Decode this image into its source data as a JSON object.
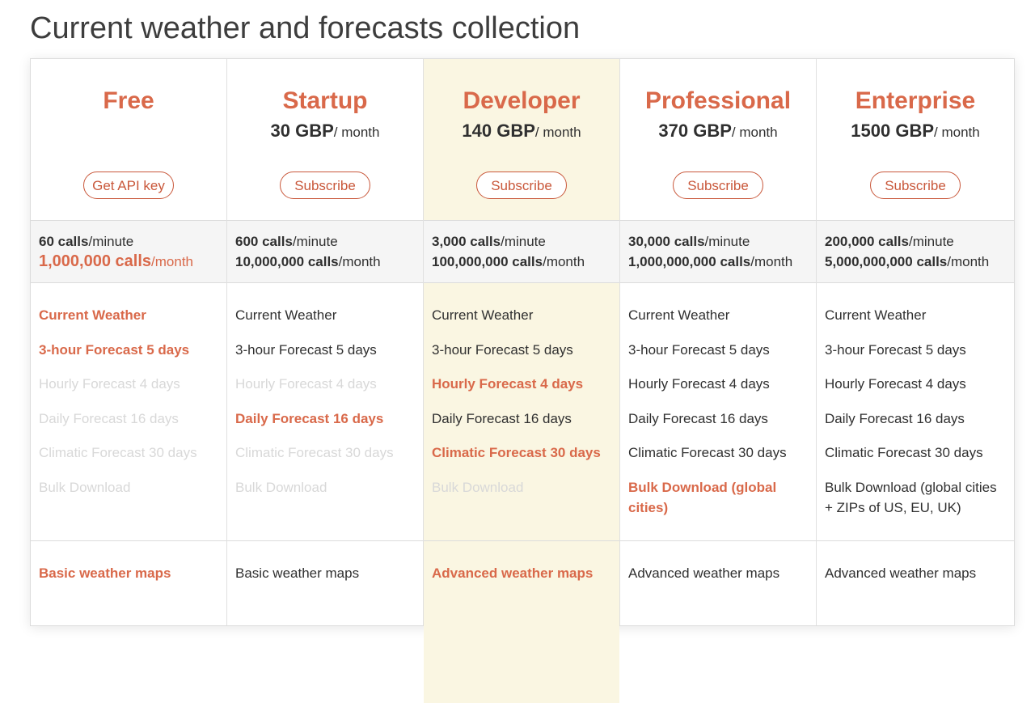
{
  "title": "Current weather and forecasts collection",
  "plans": [
    {
      "name": "Free",
      "price": "",
      "per": "",
      "button": "Get API key",
      "calls_min": [
        "60",
        " calls",
        "/minute"
      ],
      "calls_month": [
        "1,000,000",
        " calls",
        "/month"
      ],
      "features": [
        {
          "text": "Current Weather",
          "state": "hl"
        },
        {
          "text": "3-hour Forecast 5 days",
          "state": "hl"
        },
        {
          "text": "Hourly Forecast 4 days",
          "state": "off"
        },
        {
          "text": "Daily Forecast 16 days",
          "state": "off"
        },
        {
          "text": "Climatic Forecast 30 days",
          "state": "off"
        },
        {
          "text": "Bulk Download",
          "state": "off"
        }
      ],
      "maps": {
        "text": "Basic weather maps",
        "state": "hl"
      }
    },
    {
      "name": "Startup",
      "price": "30 GBP",
      "per": "/ month",
      "button": "Subscribe",
      "calls_min": [
        "600",
        " calls",
        "/minute"
      ],
      "calls_month": [
        "10,000,000",
        " calls",
        "/month"
      ],
      "features": [
        {
          "text": "Current Weather",
          "state": "on"
        },
        {
          "text": "3-hour Forecast 5 days",
          "state": "on"
        },
        {
          "text": "Hourly Forecast 4 days",
          "state": "off"
        },
        {
          "text": "Daily Forecast 16 days",
          "state": "hl"
        },
        {
          "text": "Climatic Forecast 30 days",
          "state": "off"
        },
        {
          "text": "Bulk Download",
          "state": "off"
        }
      ],
      "maps": {
        "text": "Basic weather maps",
        "state": "on"
      }
    },
    {
      "name": "Developer",
      "price": "140 GBP",
      "per": "/ month",
      "button": "Subscribe",
      "calls_min": [
        "3,000",
        " calls",
        "/minute"
      ],
      "calls_month": [
        "100,000,000",
        " calls",
        "/month"
      ],
      "features": [
        {
          "text": "Current Weather",
          "state": "on"
        },
        {
          "text": "3-hour Forecast 5 days",
          "state": "on"
        },
        {
          "text": "Hourly Forecast 4 days",
          "state": "hl"
        },
        {
          "text": "Daily Forecast 16 days",
          "state": "on"
        },
        {
          "text": "Climatic Forecast 30 days",
          "state": "hl"
        },
        {
          "text": "Bulk Download",
          "state": "off"
        }
      ],
      "maps": {
        "text": "Advanced weather maps",
        "state": "hl"
      }
    },
    {
      "name": "Professional",
      "price": "370 GBP",
      "per": "/ month",
      "button": "Subscribe",
      "calls_min": [
        "30,000",
        " calls",
        "/minute"
      ],
      "calls_month": [
        "1,000,000,000",
        " calls",
        "/month"
      ],
      "features": [
        {
          "text": "Current Weather",
          "state": "on"
        },
        {
          "text": "3-hour Forecast 5 days",
          "state": "on"
        },
        {
          "text": "Hourly Forecast 4 days",
          "state": "on"
        },
        {
          "text": "Daily Forecast 16 days",
          "state": "on"
        },
        {
          "text": "Climatic Forecast 30 days",
          "state": "on"
        },
        {
          "text": "Bulk Download (global cities)",
          "state": "hl"
        }
      ],
      "maps": {
        "text": "Advanced weather maps",
        "state": "on"
      }
    },
    {
      "name": "Enterprise",
      "price": "1500 GBP",
      "per": "/ month",
      "button": "Subscribe",
      "calls_min": [
        "200,000",
        " calls",
        "/minute"
      ],
      "calls_month": [
        "5,000,000,000",
        " calls",
        "/month"
      ],
      "features": [
        {
          "text": "Current Weather",
          "state": "on"
        },
        {
          "text": "3-hour Forecast 5 days",
          "state": "on"
        },
        {
          "text": "Hourly Forecast 4 days",
          "state": "on"
        },
        {
          "text": "Daily Forecast 16 days",
          "state": "on"
        },
        {
          "text": "Climatic Forecast 30 days",
          "state": "on"
        },
        {
          "text": "Bulk Download (global cities + ZIPs of US, EU, UK)",
          "state": "on"
        }
      ],
      "maps": {
        "text": "Advanced weather maps",
        "state": "on"
      }
    }
  ],
  "colors": {
    "accent": "#d9694a",
    "button_border": "#c9583b",
    "highlight_bg": "#faf6e2",
    "calls_bg": "#f5f5f5",
    "disabled": "#d8d8d8"
  }
}
